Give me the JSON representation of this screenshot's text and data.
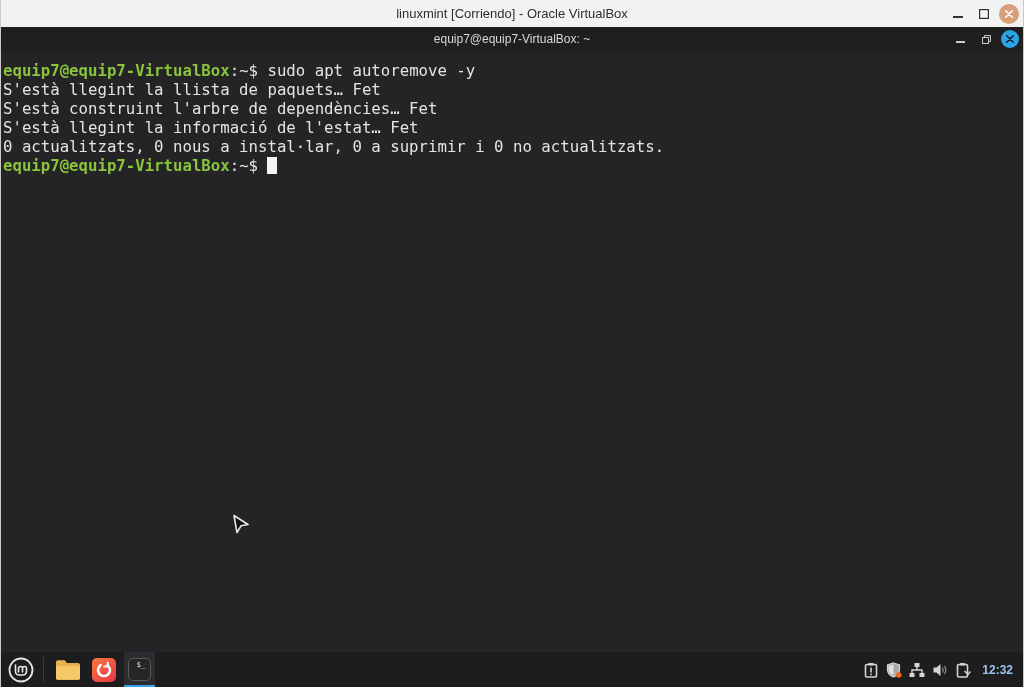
{
  "host_window": {
    "title": "linuxmint [Corriendo] - Oracle VirtualBox"
  },
  "terminal": {
    "title": "equip7@equip7-VirtualBox: ~",
    "lines": [
      {
        "text": "**equip7@equip7-VirtualBox**:~$ sudo apt autoremove -y",
        "cursor": false
      },
      {
        "text": "S'està llegint la llista de paquets… Fet",
        "cursor": false
      },
      {
        "text": "S'està construint l'arbre de dependències… Fet",
        "cursor": false
      },
      {
        "text": "S'està llegint la informació de l'estat… Fet",
        "cursor": false
      },
      {
        "text": "0 actualitzats, 0 nous a instal·lar, 0 a suprimir i 0 no actualitzats.",
        "cursor": false
      },
      {
        "text": "**equip7@equip7-VirtualBox**:~$",
        "cursor": true
      }
    ]
  },
  "taskbar": {
    "apps": [
      {
        "kind": "folder",
        "selected": false
      },
      {
        "kind": "swirl",
        "selected": false
      },
      {
        "kind": "terminal",
        "label": "$_",
        "selected": true
      }
    ],
    "clock": "12:32"
  }
}
